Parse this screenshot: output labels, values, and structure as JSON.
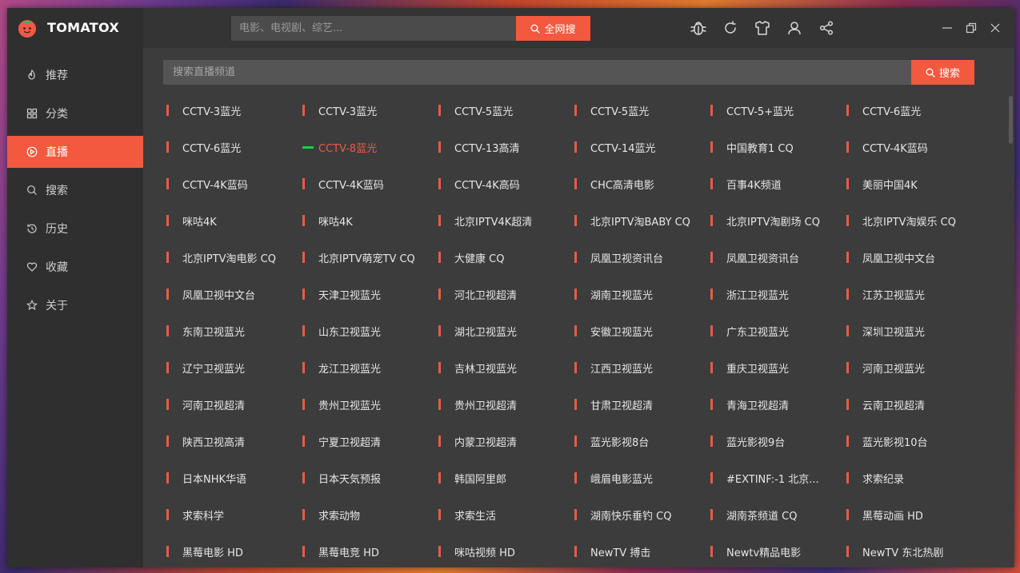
{
  "app": {
    "name": "TOMATOX",
    "colors": {
      "accent": "#f2593f",
      "playing_indicator": "#27c93f",
      "background": "#3c3c3c",
      "sidebar": "#2f2f2f"
    }
  },
  "header": {
    "search": {
      "placeholder": "电影、电视剧、综艺..."
    },
    "search_button": "全网搜",
    "tools": [
      "bug-icon",
      "refresh-icon",
      "shirt-icon",
      "user-icon",
      "share-icon"
    ],
    "window_controls": [
      "minimize-icon",
      "restore-icon",
      "close-icon"
    ]
  },
  "sidebar": {
    "items": [
      {
        "label": "推荐",
        "icon": "flame-icon",
        "active": false
      },
      {
        "label": "分类",
        "icon": "grid-icon",
        "active": false
      },
      {
        "label": "直播",
        "icon": "play-circle-icon",
        "active": true
      },
      {
        "label": "搜索",
        "icon": "search-icon",
        "active": false
      },
      {
        "label": "历史",
        "icon": "history-icon",
        "active": false
      },
      {
        "label": "收藏",
        "icon": "heart-icon",
        "active": false
      },
      {
        "label": "关于",
        "icon": "star-icon",
        "active": false
      }
    ]
  },
  "main": {
    "search": {
      "placeholder": "搜索直播频道"
    },
    "search_button": "搜索",
    "playing_index": 7,
    "channels": [
      "CCTV-3蓝光",
      "CCTV-3蓝光",
      "CCTV-5蓝光",
      "CCTV-5蓝光",
      "CCTV-5+蓝光",
      "CCTV-6蓝光",
      "CCTV-6蓝光",
      "CCTV-8蓝光",
      "CCTV-13高清",
      "CCTV-14蓝光",
      "中国教育1 CQ",
      "CCTV-4K蓝码",
      "CCTV-4K蓝码",
      "CCTV-4K蓝码",
      "CCTV-4K高码",
      "CHC高清电影",
      "百事4K频道",
      "美丽中国4K",
      "咪咕4K",
      "咪咕4K",
      "北京IPTV4K超清",
      "北京IPTV淘BABY CQ",
      "北京IPTV淘剧场 CQ",
      "北京IPTV淘娱乐 CQ",
      "北京IPTV淘电影 CQ",
      "北京IPTV萌宠TV CQ",
      "大健康 CQ",
      "凤凰卫视资讯台",
      "凤凰卫视资讯台",
      "凤凰卫视中文台",
      "凤凰卫视中文台",
      "天津卫视蓝光",
      "河北卫视超清",
      "湖南卫视蓝光",
      "浙江卫视蓝光",
      "江苏卫视蓝光",
      "东南卫视蓝光",
      "山东卫视蓝光",
      "湖北卫视蓝光",
      "安徽卫视蓝光",
      "广东卫视蓝光",
      "深圳卫视蓝光",
      "辽宁卫视蓝光",
      "龙江卫视蓝光",
      "吉林卫视蓝光",
      "江西卫视蓝光",
      "重庆卫视蓝光",
      "河南卫视蓝光",
      "河南卫视超清",
      "贵州卫视蓝光",
      "贵州卫视超清",
      "甘肃卫视超清",
      "青海卫视超清",
      "云南卫视超清",
      "陕西卫视高清",
      "宁夏卫视超清",
      "内蒙卫视超清",
      "蓝光影视8台",
      "蓝光影视9台",
      "蓝光影视10台",
      "日本NHK华语",
      "日本天気预报",
      "韩国阿里郎",
      "峨眉电影蓝光",
      "#EXTINF:-1 北京...",
      "求索纪录",
      "求索科学",
      "求索动物",
      "求索生活",
      "湖南快乐垂钓 CQ",
      "湖南茶频道 CQ",
      "黑莓动画 HD",
      "黑莓电影 HD",
      "黑莓电竞 HD",
      "咪咕视频 HD",
      "NewTV 搏击",
      "Newtv精品电影",
      "NewTV 东北热剧"
    ]
  }
}
